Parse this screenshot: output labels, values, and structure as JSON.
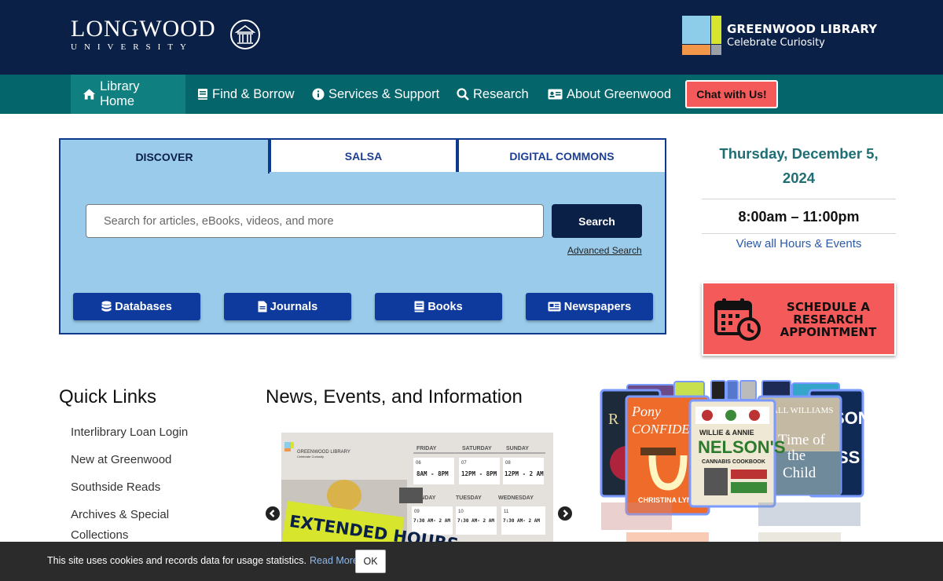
{
  "header": {
    "university_name": "LONGWOOD",
    "university_sub": "UNIVERSITY",
    "library_name": "GREENWOOD LIBRARY",
    "library_tagline": "Celebrate Curiosity",
    "logo_colors": [
      "#8ecdea",
      "#d7e62c",
      "#f2974a",
      "#9aa0a6"
    ]
  },
  "nav": {
    "items": [
      {
        "label": "Library Home",
        "icon": "home-icon"
      },
      {
        "label": "Find & Borrow",
        "icon": "book-icon"
      },
      {
        "label": "Services & Support",
        "icon": "info-icon"
      },
      {
        "label": "Research",
        "icon": "search-icon"
      },
      {
        "label": "About Greenwood",
        "icon": "id-card-icon"
      }
    ],
    "chat_label": "Chat with Us!"
  },
  "search": {
    "tabs": [
      "DISCOVER",
      "SALSA",
      "DIGITAL COMMONS"
    ],
    "placeholder": "Search for articles, eBooks, videos, and more",
    "button": "Search",
    "advanced": "Advanced Search",
    "resources": [
      {
        "label": "Databases",
        "icon": "database-icon"
      },
      {
        "label": "Journals",
        "icon": "file-icon"
      },
      {
        "label": "Books",
        "icon": "book-icon"
      },
      {
        "label": "Newspapers",
        "icon": "newspaper-icon"
      }
    ]
  },
  "hours": {
    "date": "Thursday, December 5, 2024",
    "time": "8:00am – 11:00pm",
    "link": "View all Hours & Events"
  },
  "appointment": {
    "label": "SCHEDULE A RESEARCH APPOINTMENT",
    "icon": "calendar-clock-icon"
  },
  "quick_links": {
    "title": "Quick Links",
    "items": [
      "Interlibrary Loan Login",
      "New at Greenwood",
      "Southside Reads",
      "Archives & Special Collections"
    ]
  },
  "news": {
    "title": "News, Events, and Information",
    "slide": {
      "logo_text": "GREENWOOD LIBRARY",
      "logo_sub": "Celebrate Curiosity",
      "days": [
        "FRIDAY",
        "SATURDAY",
        "SUNDAY",
        "MONDAY",
        "TUESDAY",
        "WEDNESDAY"
      ],
      "dates": [
        "06",
        "07",
        "08",
        "09",
        "10",
        "11"
      ],
      "hours": [
        "8AM - 8PM",
        "12PM - 8PM",
        "12PM - 2 AM",
        "7:30 AM- 2 AM",
        "7:30 AM- 2 AM",
        "7:30 AM- 2 AM"
      ],
      "banner": "EXTENDED HOURS"
    }
  },
  "books": {
    "titles": [
      "Pony Confidential",
      "Willie & Annie Nelson's Cannabis Cookbook",
      "Time of the Child"
    ],
    "authors": [
      "Christina Lynch",
      "Willie & Annie Nelson",
      "Niall Williams"
    ]
  },
  "cookie": {
    "text": "This site uses cookies and records data for usage statistics.",
    "link": "Read More",
    "ok": "OK"
  }
}
